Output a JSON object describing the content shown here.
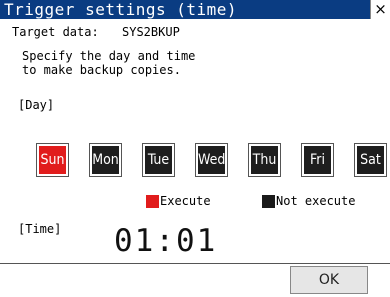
{
  "window": {
    "title": "Trigger settings (time)",
    "close_glyph": "×"
  },
  "target": {
    "label": "Target data:",
    "value": "SYS2BKUP"
  },
  "instruction": "Specify the day and time\nto make backup copies.",
  "day_section": {
    "label": "[Day]",
    "days": [
      {
        "label": "Sun",
        "selected": true
      },
      {
        "label": "Mon",
        "selected": false
      },
      {
        "label": "Tue",
        "selected": false
      },
      {
        "label": "Wed",
        "selected": false
      },
      {
        "label": "Thu",
        "selected": false
      },
      {
        "label": "Fri",
        "selected": false
      },
      {
        "label": "Sat",
        "selected": false
      }
    ]
  },
  "legend": {
    "execute_label": "Execute",
    "not_execute_label": "Not execute"
  },
  "time_section": {
    "label": "[Time]",
    "value": "01:01"
  },
  "footer": {
    "ok_label": "OK"
  },
  "colors": {
    "title_bar": "#0a3c82",
    "selected_day": "#e11c1c",
    "unselected_day": "#1e1e1e"
  }
}
